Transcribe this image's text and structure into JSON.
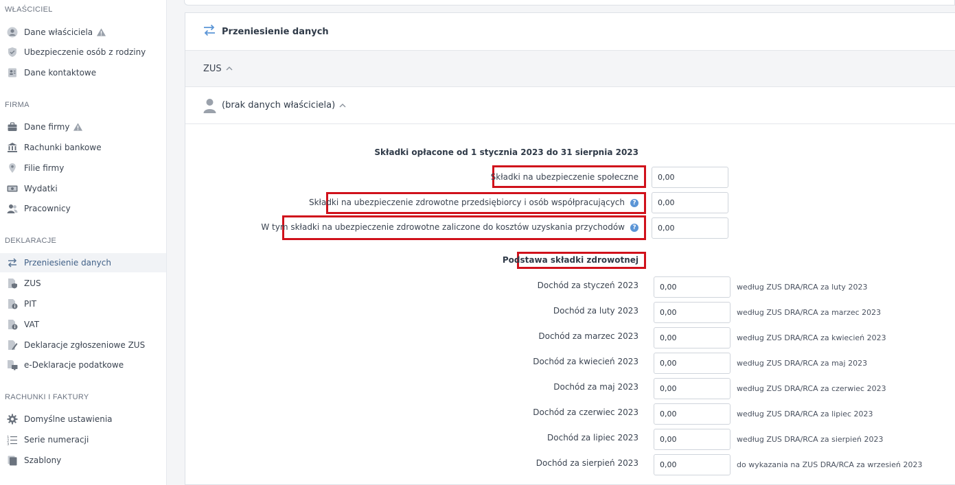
{
  "sidebar": {
    "owner_section": "WŁAŚCICIEL",
    "owner_items": [
      {
        "label": "Dane właściciela",
        "icon": "user-circle-icon",
        "warning": true
      },
      {
        "label": "Ubezpieczenie osób z rodziny",
        "icon": "shield-icon",
        "warning": false
      },
      {
        "label": "Dane kontaktowe",
        "icon": "contact-card-icon",
        "warning": false
      }
    ],
    "company_section": "FIRMA",
    "company_items": [
      {
        "label": "Dane firmy",
        "icon": "briefcase-icon",
        "warning": true
      },
      {
        "label": "Rachunki bankowe",
        "icon": "bank-icon",
        "warning": false
      },
      {
        "label": "Filie firmy",
        "icon": "map-pin-icon",
        "warning": false
      },
      {
        "label": "Wydatki",
        "icon": "money-icon",
        "warning": false
      },
      {
        "label": "Pracownicy",
        "icon": "users-icon",
        "warning": false
      }
    ],
    "decl_section": "DEKLARACJE",
    "decl_items": [
      {
        "label": "Przeniesienie danych",
        "icon": "transfer-arrows-icon",
        "active": true
      },
      {
        "label": "ZUS",
        "icon": "doc-shield-icon",
        "active": false
      },
      {
        "label": "PIT",
        "icon": "doc-info-icon",
        "active": false
      },
      {
        "label": "VAT",
        "icon": "doc-info-icon",
        "active": false
      },
      {
        "label": "Deklaracje zgłoszeniowe ZUS",
        "icon": "doc-edit-icon",
        "active": false
      },
      {
        "label": "e-Deklaracje podatkowe",
        "icon": "doc-monitor-icon",
        "active": false
      }
    ],
    "bills_section": "RACHUNKI I FAKTURY",
    "bills_items": [
      {
        "label": "Domyślne ustawienia",
        "icon": "gear-icon"
      },
      {
        "label": "Serie numeracji",
        "icon": "numbered-list-icon"
      },
      {
        "label": "Szablony",
        "icon": "templates-icon"
      }
    ]
  },
  "main": {
    "card_title": "Przeniesienie danych",
    "zus_label": "ZUS",
    "owner_label": "(brak danych właściciela)",
    "paid_header": "Składki opłacone od 1 stycznia 2023 do 31 sierpnia 2023",
    "fields": [
      {
        "label": "Składki na ubezpieczenie społeczne",
        "value": "0,00",
        "help": false
      },
      {
        "label": "Składki na ubezpieczenie zdrowotne przedsiębiorcy i osób współpracujących",
        "value": "0,00",
        "help": true
      },
      {
        "label": "W tym składki na ubezpieczenie zdrowotne zaliczone do kosztów uzyskania przychodów",
        "value": "0,00",
        "help": true
      }
    ],
    "health_header": "Podstawa składki zdrowotnej",
    "income_rows": [
      {
        "label": "Dochód za styczeń 2023",
        "value": "0,00",
        "note": "według ZUS DRA/RCA za luty 2023"
      },
      {
        "label": "Dochód za luty 2023",
        "value": "0,00",
        "note": "według ZUS DRA/RCA za marzec 2023"
      },
      {
        "label": "Dochód za marzec 2023",
        "value": "0,00",
        "note": "według ZUS DRA/RCA za kwiecień 2023"
      },
      {
        "label": "Dochód za kwiecień 2023",
        "value": "0,00",
        "note": "według ZUS DRA/RCA za maj 2023"
      },
      {
        "label": "Dochód za maj 2023",
        "value": "0,00",
        "note": "według ZUS DRA/RCA za czerwiec 2023"
      },
      {
        "label": "Dochód za czerwiec 2023",
        "value": "0,00",
        "note": "według ZUS DRA/RCA za lipiec 2023"
      },
      {
        "label": "Dochód za lipiec 2023",
        "value": "0,00",
        "note": "według ZUS DRA/RCA za sierpień 2023"
      },
      {
        "label": "Dochód za sierpień 2023",
        "value": "0,00",
        "note": "do wykazania na ZUS DRA/RCA za wrzesień 2023"
      }
    ],
    "help_glyph": "?"
  },
  "colors": {
    "accent": "#3f5f86",
    "highlight": "#d0111b",
    "help": "#5b95d6",
    "transfer_icon": "#5b95d6"
  }
}
